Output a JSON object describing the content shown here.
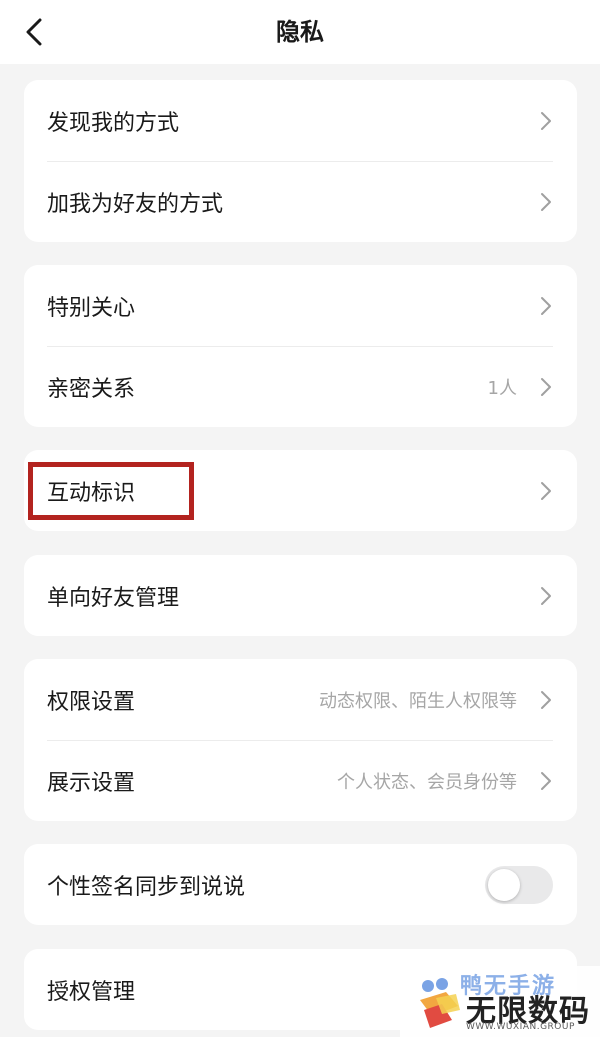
{
  "header": {
    "title": "隐私"
  },
  "groups": [
    {
      "rows": [
        {
          "label": "发现我的方式"
        },
        {
          "label": "加我为好友的方式"
        }
      ]
    },
    {
      "rows": [
        {
          "label": "特别关心"
        },
        {
          "label": "亲密关系",
          "value": "1人"
        }
      ]
    },
    {
      "rows": [
        {
          "label": "互动标识"
        }
      ]
    },
    {
      "rows": [
        {
          "label": "单向好友管理"
        }
      ]
    },
    {
      "rows": [
        {
          "label": "权限设置",
          "value": "动态权限、陌生人权限等"
        },
        {
          "label": "展示设置",
          "value": "个人状态、会员身份等"
        }
      ]
    },
    {
      "rows": [
        {
          "label": "个性签名同步到说说",
          "toggle": false
        }
      ]
    },
    {
      "rows": [
        {
          "label": "授权管理"
        }
      ]
    }
  ],
  "watermark": {
    "top_text": "鸭无手游",
    "main_text": "无限数码",
    "sub_text": "WWW.WUXIAN.GROUP"
  },
  "colors": {
    "highlight": "#b3231f",
    "background": "#f4f4f4",
    "card": "#ffffff"
  }
}
